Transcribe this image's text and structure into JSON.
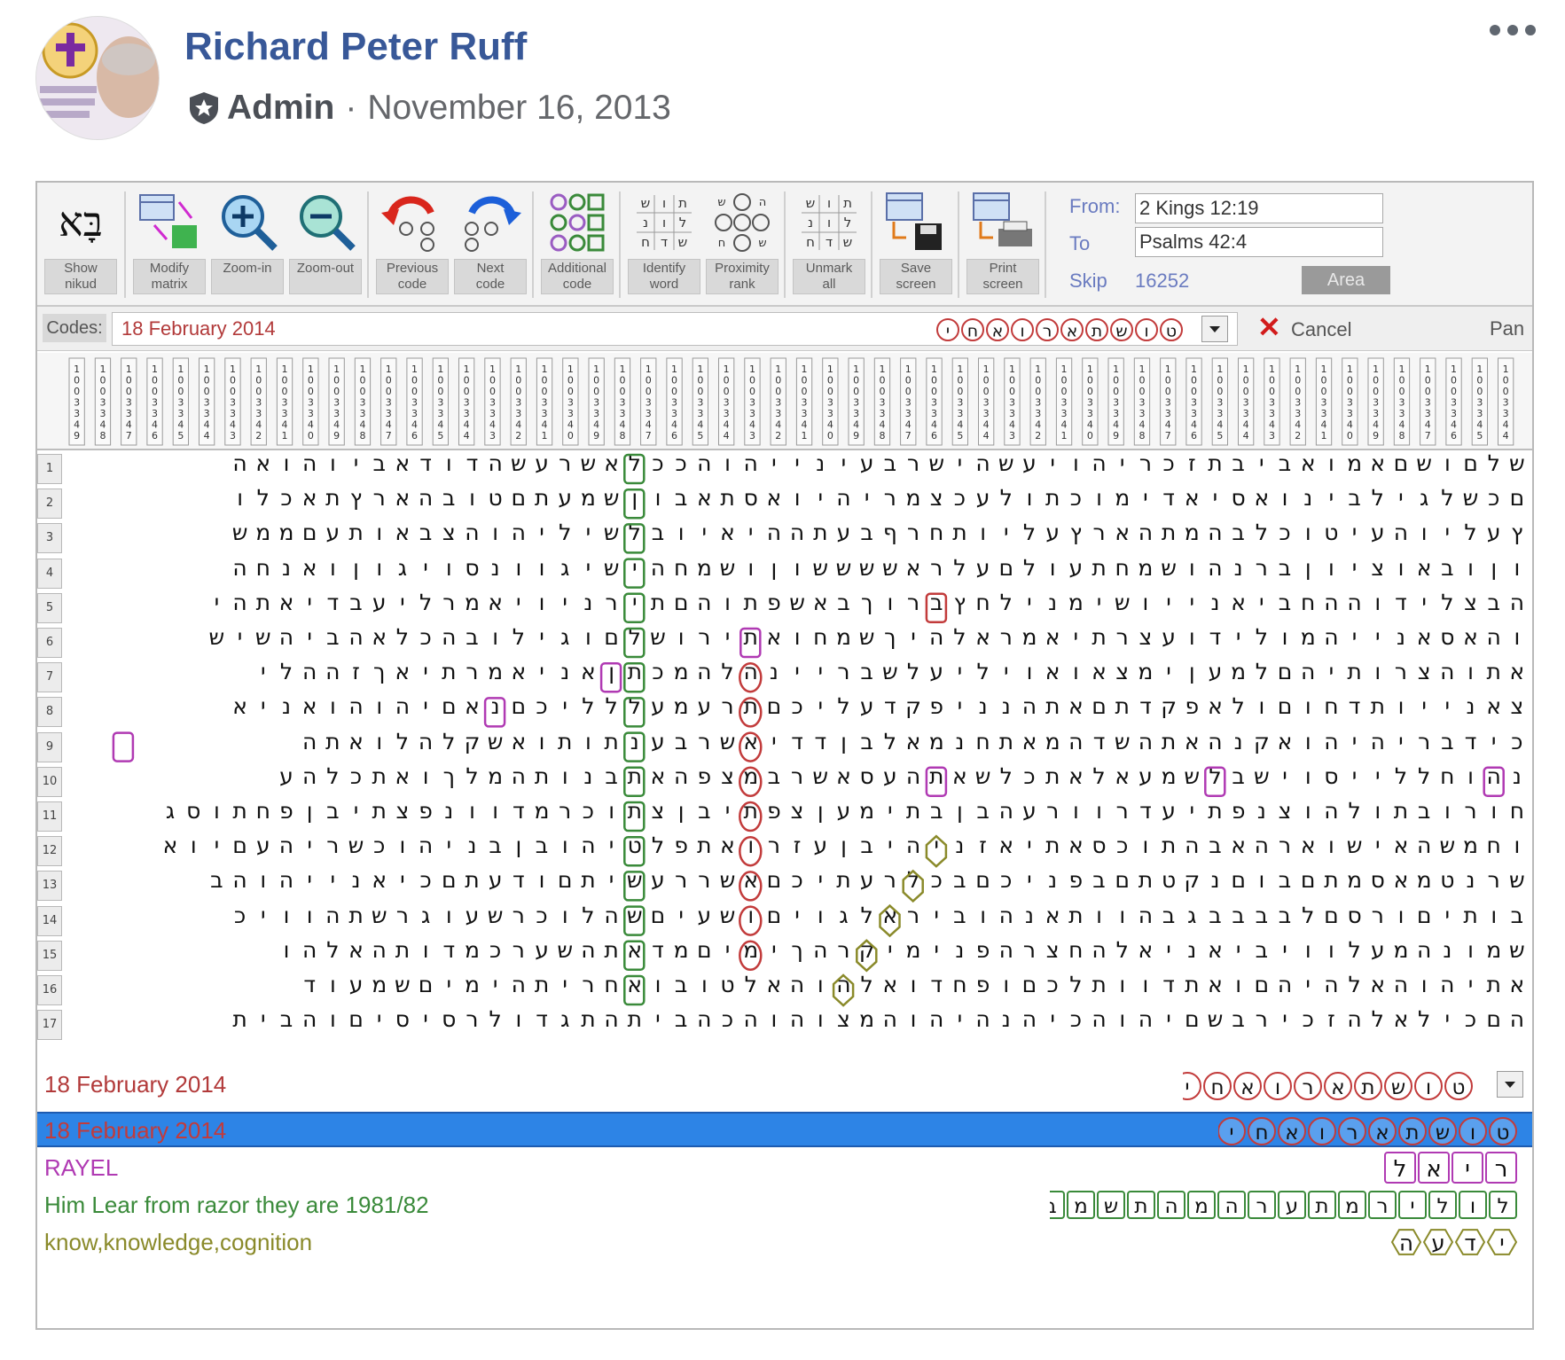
{
  "post": {
    "author": "Richard Peter Ruff",
    "role": "Admin",
    "separator": "·",
    "date": "November 16, 2013",
    "more_icon": "ellipsis-icon"
  },
  "toolbar": {
    "buttons": [
      {
        "label": "Show\nnikud",
        "icon": "hebrew-nikud-icon"
      },
      {
        "label": "Modify\nmatrix",
        "icon": "modify-matrix-icon"
      },
      {
        "label": "Zoom-in",
        "icon": "zoom-in-icon"
      },
      {
        "label": "Zoom-out",
        "icon": "zoom-out-icon"
      },
      {
        "label": "Previous\ncode",
        "icon": "previous-code-icon"
      },
      {
        "label": "Next\ncode",
        "icon": "next-code-icon"
      },
      {
        "label": "Additional\ncode",
        "icon": "additional-code-icon"
      },
      {
        "label": "Identify\nword",
        "icon": "identify-word-icon"
      },
      {
        "label": "Proximity\nrank",
        "icon": "proximity-rank-icon"
      },
      {
        "label": "Unmark\nall",
        "icon": "unmark-all-icon"
      },
      {
        "label": "Save\nscreen",
        "icon": "save-screen-icon"
      },
      {
        "label": "Print\nscreen",
        "icon": "print-screen-icon"
      }
    ],
    "from_label": "From:",
    "from_value": "2 Kings 12:19",
    "to_label": "To",
    "to_value": "Psalms 42:4",
    "skip_label": "Skip",
    "skip_value": "16252",
    "area_label": "Area"
  },
  "codes": {
    "label": "Codes:",
    "value": "18 February 2014",
    "letters": "ט ו ש ת א ר ו א ח י",
    "cancel_label": "Cancel",
    "pan_label": "Pan"
  },
  "grid": {
    "rows": [
      "שלםושםאמואביבתזכריהויעשהישרבעינייהוהככלאשרעשהדודאביוהואה",
      "םכשלגילבינואסיאדימוכתולעכצמריהיואסתאבוןשמעתםטובהארץתאכלו",
      "ץעליוהעיטוכלבהמתהארץעליותחרףבעתההיאיובלשיליהוהצבאותעםממש",
      "וןובאוציוןברנהושמחתעולםעלראששששוןושמחהישיגוונסויגוןואנחה",
      "הבצלידוההחביאנייושימנילחץברוךבאשפתוהםתירניויאמרליעבדיאתהי",
      "והאסאנייהמולידועצרתיאמראלהיךשמחואתירושלםוגילובהכלאהביהשיש",
      "אתוהצרותיהםלמען ימצאואויליעלשבריינהלהמכתןאניאמרתיאךזההלי",
      "צאנייותדחוםולאפקדתםאתהנניפקדעליכםתרעמעללליכםנאםיהוהואניא",
      "כידבריהיהואקנהאתהשדהמאתחנמאלבןדדיאשרבענתותואשקלהלואתה",
      "נהוחללייסוישבלשמעאלאתכלשאתהעסאשרבמצפהאתבנותהמלךואתכלהע",
      "חורובתולהוצנפתיעדרוורעהבןבתימעןצפתיבןצתוכרמדוונפצתיבןפחתוסג",
      "וחמשהאישוארהאבהתוכסאתיאזניהיבןעזרואתפלטיהובןבניהוכשריהעםיוא",
      "שרנטמאסמתםבוםנקטתםבפניכםבכלרעתיכםאשררעשיתםודעתםכיאנייהוהב",
      "בותיםורסםלבבבבגבהוותאנהוביראלגויםושעיםשהלוכרשעוגרשתהוויכ",
      "שמונהמעלוויביאניאלהחצרהפנימיקרהךימיםמדאתהשערכמדותהאלהו",
      "אתיהוהאלהיהםואתדוותלכםופחדואלהוהאלטובואחריתהימיםשמעוד",
      "הםכילאלהזכירבשםיהוהכיהנהיהוהמצוהוהכהבית התגדולרסיסיםוהבית"
    ]
  },
  "results": {
    "list_title": "18 February 2014",
    "list_letters": "ט ו ש ת א ר ו א ח י",
    "selected_title": "18 February 2014",
    "selected_letters": "ט ו ש ת א ר ו א ח י",
    "items": [
      {
        "text": "RAYEL",
        "color": "#b03ab3",
        "letters": "ר י א ל"
      },
      {
        "text": "Him Lear from razor they are 1981/82",
        "color": "#3a8a3a",
        "letters": "ל ו ל י ר מ ת ע ר ה מ ה ת ש מ ב"
      },
      {
        "text": "know,knowledge,cognition",
        "color": "#8a8a2a",
        "letters": "י ד ע ה"
      }
    ]
  },
  "colors": {
    "author": "#385898",
    "selection": "#2d84e6",
    "code_red": "#c23b3b",
    "code_green": "#3a8a3a",
    "code_purple": "#b03ab3",
    "code_olive": "#8a8a2a"
  }
}
